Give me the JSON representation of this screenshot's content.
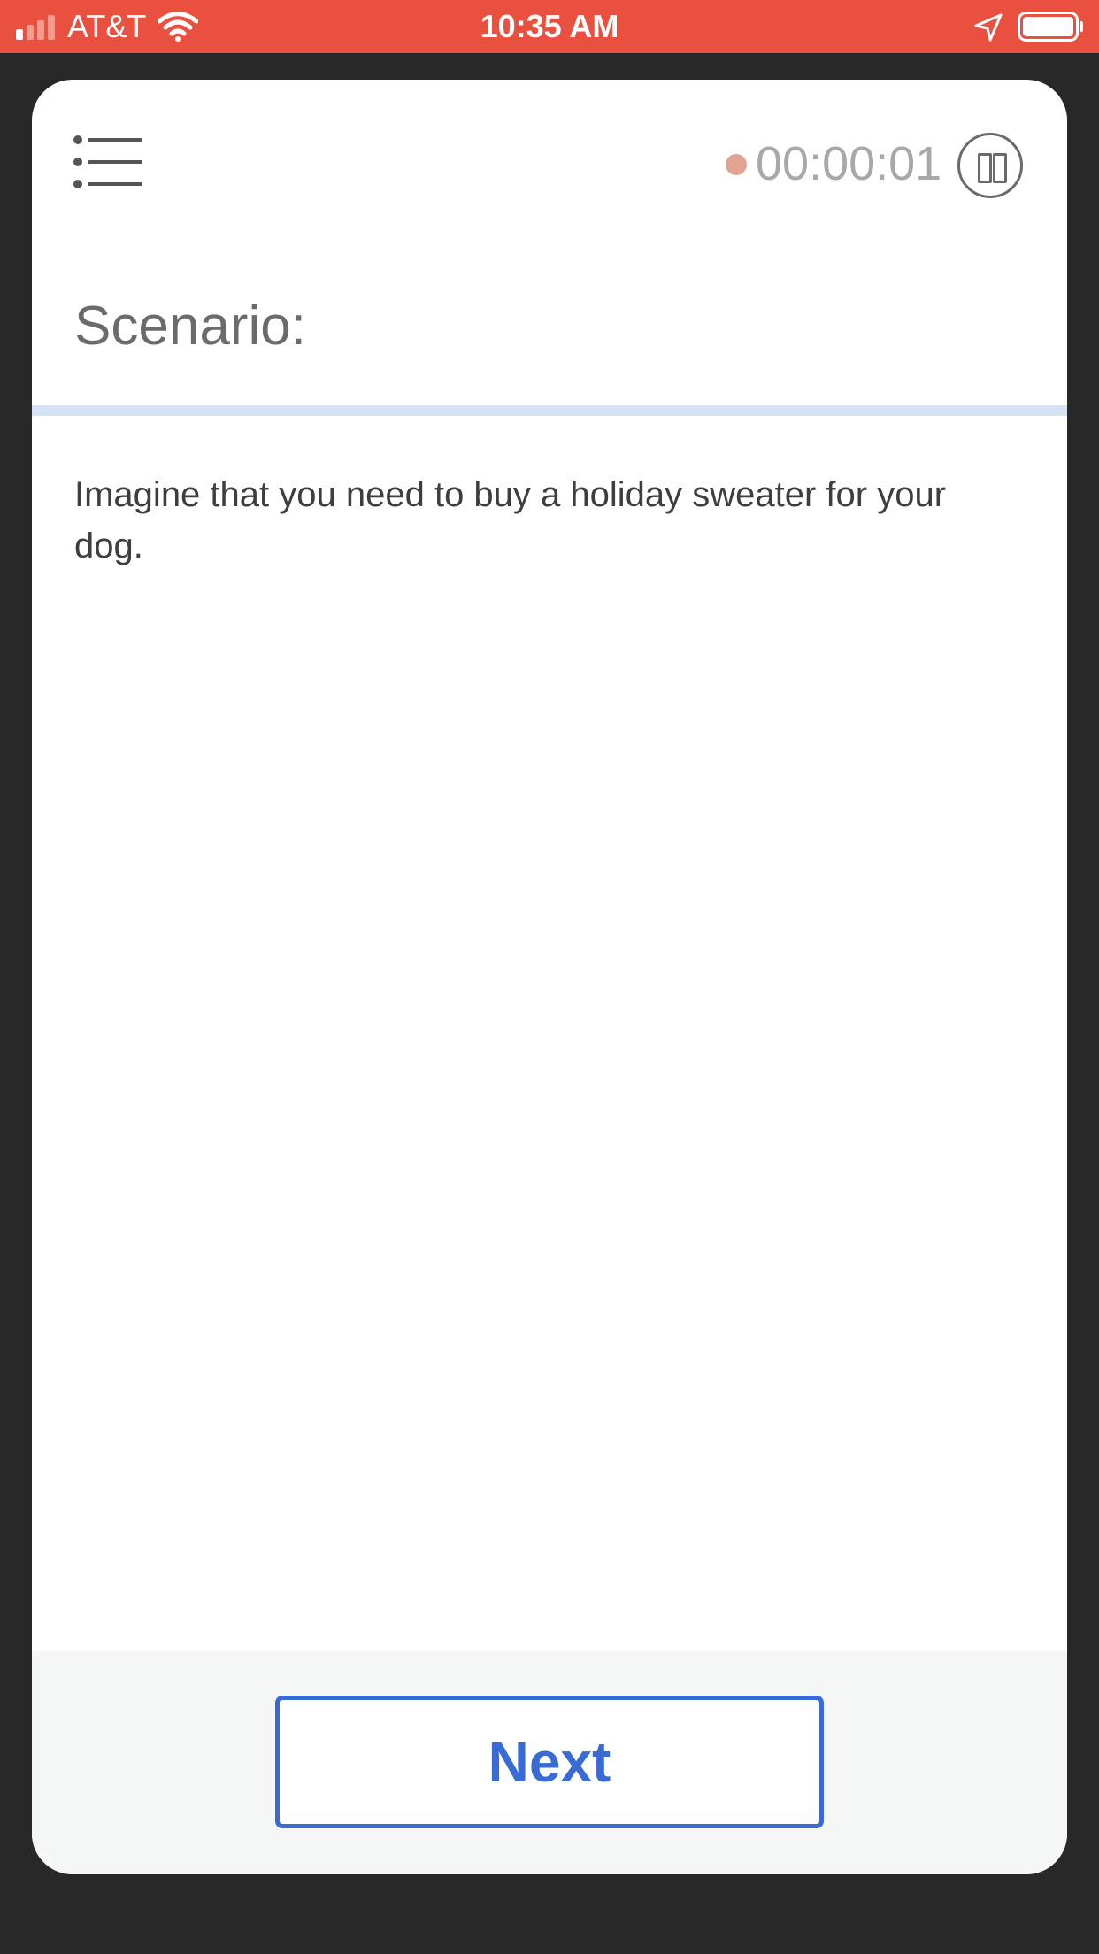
{
  "status_bar": {
    "carrier": "AT&T",
    "time": "10:35 AM",
    "background_color": "#ea503f",
    "icons": [
      "signal-icon",
      "wifi-icon",
      "location-arrow-icon",
      "battery-icon"
    ]
  },
  "header": {
    "menu_icon": "list-icon",
    "timer": "00:00:01",
    "recording_dot_color": "#e2a393",
    "pause_icon": "pause-icon"
  },
  "scenario": {
    "title": "Scenario:",
    "text": "Imagine that you need to buy a holiday sweater for your dog."
  },
  "footer": {
    "next_label": "Next",
    "accent_color": "#3a6bd4"
  }
}
